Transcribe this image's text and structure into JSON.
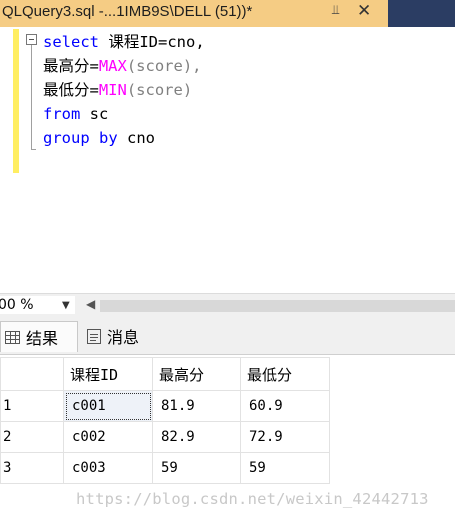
{
  "tab": {
    "title": "QLQuery3.sql -...1IMB9S\\DELL (51))*",
    "pin_glyph": "⫫",
    "close_glyph": "✕"
  },
  "editor": {
    "line1": {
      "kw": "select",
      "rest": " 课程ID=cno,"
    },
    "line2": {
      "pre": "最高分=",
      "fn": "MAX",
      "post": "(score),"
    },
    "line3": {
      "pre": "最低分=",
      "fn": "MIN",
      "post": "(score)"
    },
    "line4": {
      "kw": "from",
      "rest": " sc"
    },
    "line5": {
      "kw": "group by",
      "rest": " cno"
    }
  },
  "zoom": {
    "value": "00 %"
  },
  "results_tabs": {
    "results_label": "结果",
    "messages_label": "消息"
  },
  "grid": {
    "headers": [
      "课程ID",
      "最高分",
      "最低分"
    ],
    "rows": [
      {
        "num": "1",
        "cno": "c001",
        "max": "81.9",
        "min": "60.9"
      },
      {
        "num": "2",
        "cno": "c002",
        "max": "82.9",
        "min": "72.9"
      },
      {
        "num": "3",
        "cno": "c003",
        "max": "59",
        "min": "59"
      }
    ]
  },
  "watermark": "https://blog.csdn.net/weixin_42442713"
}
